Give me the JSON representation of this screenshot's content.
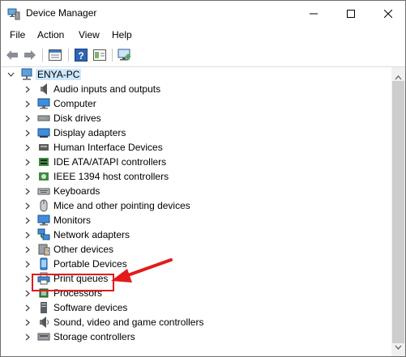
{
  "window": {
    "title": "Device Manager"
  },
  "menu": [
    "File",
    "Action",
    "View",
    "Help"
  ],
  "tree": {
    "root": "ENYA-PC",
    "items": [
      {
        "label": "Audio inputs and outputs",
        "icon": "speaker-icon"
      },
      {
        "label": "Computer",
        "icon": "monitor-icon"
      },
      {
        "label": "Disk drives",
        "icon": "disk-drive-icon"
      },
      {
        "label": "Display adapters",
        "icon": "display-adapter-icon"
      },
      {
        "label": "Human Interface Devices",
        "icon": "hid-icon"
      },
      {
        "label": "IDE ATA/ATAPI controllers",
        "icon": "ide-controller-icon"
      },
      {
        "label": "IEEE 1394 host controllers",
        "icon": "ieee1394-icon"
      },
      {
        "label": "Keyboards",
        "icon": "keyboard-icon"
      },
      {
        "label": "Mice and other pointing devices",
        "icon": "mouse-icon"
      },
      {
        "label": "Monitors",
        "icon": "monitor-icon"
      },
      {
        "label": "Network adapters",
        "icon": "network-icon"
      },
      {
        "label": "Other devices",
        "icon": "other-device-icon"
      },
      {
        "label": "Portable Devices",
        "icon": "portable-device-icon"
      },
      {
        "label": "Print queues",
        "icon": "printer-icon"
      },
      {
        "label": "Processors",
        "icon": "processor-icon"
      },
      {
        "label": "Software devices",
        "icon": "software-device-icon"
      },
      {
        "label": "Sound, video and game controllers",
        "icon": "sound-icon"
      },
      {
        "label": "Storage controllers",
        "icon": "storage-icon"
      }
    ]
  },
  "colors": {
    "highlight": "#e31b1b",
    "selection": "#cce8ff"
  }
}
